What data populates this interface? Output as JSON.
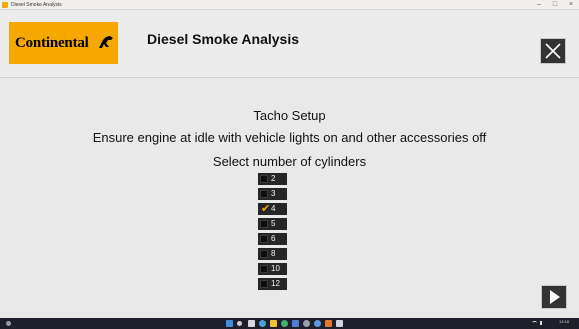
{
  "window": {
    "title": "Diesel Smoke Analysis",
    "controls": {
      "minimize": "–",
      "maximize": "□",
      "close": "×"
    }
  },
  "header": {
    "logo_text": "Continental",
    "logo_mark": "🐎",
    "title": "Diesel Smoke Analysis",
    "close_icon": "close-icon"
  },
  "main": {
    "heading": "Tacho Setup",
    "instruction": "Ensure engine at idle with vehicle lights on and other accessories off",
    "prompt": "Select number of cylinders",
    "cylinders": [
      {
        "label": "2",
        "checked": false
      },
      {
        "label": "3",
        "checked": false
      },
      {
        "label": "4",
        "checked": true
      },
      {
        "label": "5",
        "checked": false
      },
      {
        "label": "6",
        "checked": false
      },
      {
        "label": "8",
        "checked": false
      },
      {
        "label": "10",
        "checked": false
      },
      {
        "label": "12",
        "checked": false
      }
    ],
    "check_mark": "✔",
    "next_icon": "play-icon"
  },
  "taskbar": {
    "tray_time": "13:18",
    "tray_date": "",
    "icons": [
      "windows-start-icon",
      "search-icon",
      "task-view-icon",
      "edge-icon",
      "file-explorer-icon",
      "chrome-icon",
      "mail-icon",
      "settings-icon",
      "app-icon",
      "store-icon",
      "word-icon"
    ]
  },
  "colors": {
    "brand": "#f6a800",
    "background": "#e9e9e9",
    "button": "#333333",
    "option": "#262626",
    "taskbar": "#1f1f2b"
  }
}
